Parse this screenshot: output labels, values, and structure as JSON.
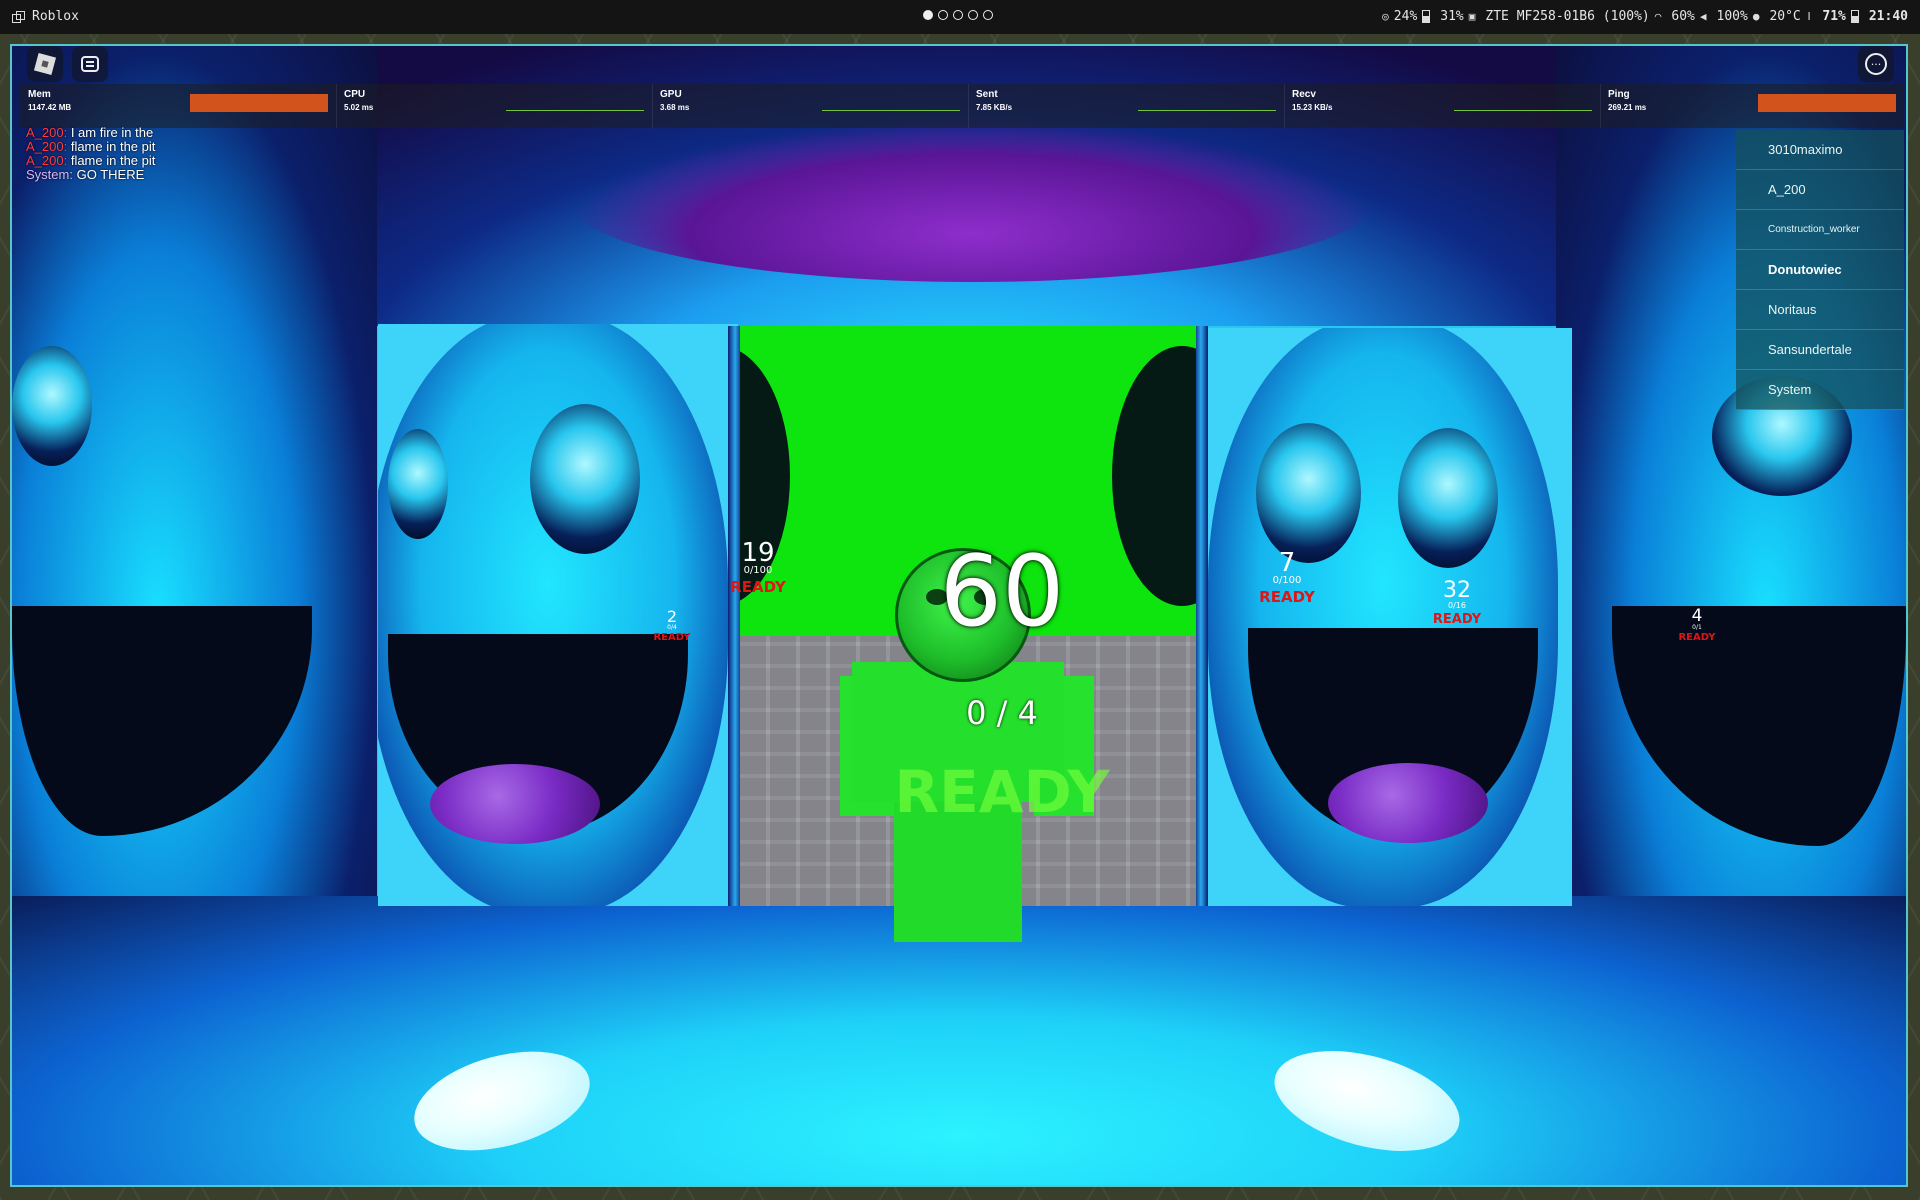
{
  "topbar": {
    "app_title": "Roblox",
    "workspaces": [
      true,
      false,
      false,
      false,
      false
    ],
    "status": {
      "brightness": "24%",
      "battery_icon": "battery-icon",
      "cpu": "31%",
      "network": "ZTE MF258-01B6 (100%)",
      "wifi_strength": "60%",
      "volume": "100%",
      "temperature": "20°C",
      "battery": "71%",
      "clock": "21:40"
    }
  },
  "stats": {
    "mem": {
      "label": "Mem",
      "value": "1147.42 MB"
    },
    "cpu": {
      "label": "CPU",
      "value": "5.02 ms"
    },
    "gpu": {
      "label": "GPU",
      "value": "3.68 ms"
    },
    "sent": {
      "label": "Sent",
      "value": "7.85 KB/s"
    },
    "recv": {
      "label": "Recv",
      "value": "15.23 KB/s"
    },
    "ping": {
      "label": "Ping",
      "value": "269.21 ms"
    }
  },
  "chat": [
    {
      "name": "A_200:",
      "text": "I am fire in the",
      "name_color": "#ff3b3b"
    },
    {
      "name": "A_200:",
      "text": "flame in the pit",
      "name_color": "#ff3b3b"
    },
    {
      "name": "A_200:",
      "text": "flame in the pit",
      "name_color": "#ff3b3b"
    },
    {
      "name": "System:",
      "text": "GO THERE",
      "name_color": "#d7b6ff"
    }
  ],
  "players": [
    "3010maximo",
    "A_200",
    "Construction_worker",
    "Donutowiec",
    "Noritaus",
    "Sansundertale",
    "System"
  ],
  "world": {
    "countdown": "60",
    "player_count": "0 / 4",
    "ready_label": "READY",
    "billboards": [
      {
        "num": "19",
        "sub": "0/100",
        "ready": "READY"
      },
      {
        "num": "2",
        "sub": "0/4",
        "ready": "READY"
      },
      {
        "num": "7",
        "sub": "0/100",
        "ready": "READY"
      },
      {
        "num": "32",
        "sub": "0/16",
        "ready": "READY"
      },
      {
        "num": "4",
        "sub": "0/1",
        "ready": "READY"
      }
    ]
  },
  "colors": {
    "accent_border": "#55c6c9",
    "ready_red": "#e01515",
    "stat_bar": "#d2531c"
  }
}
